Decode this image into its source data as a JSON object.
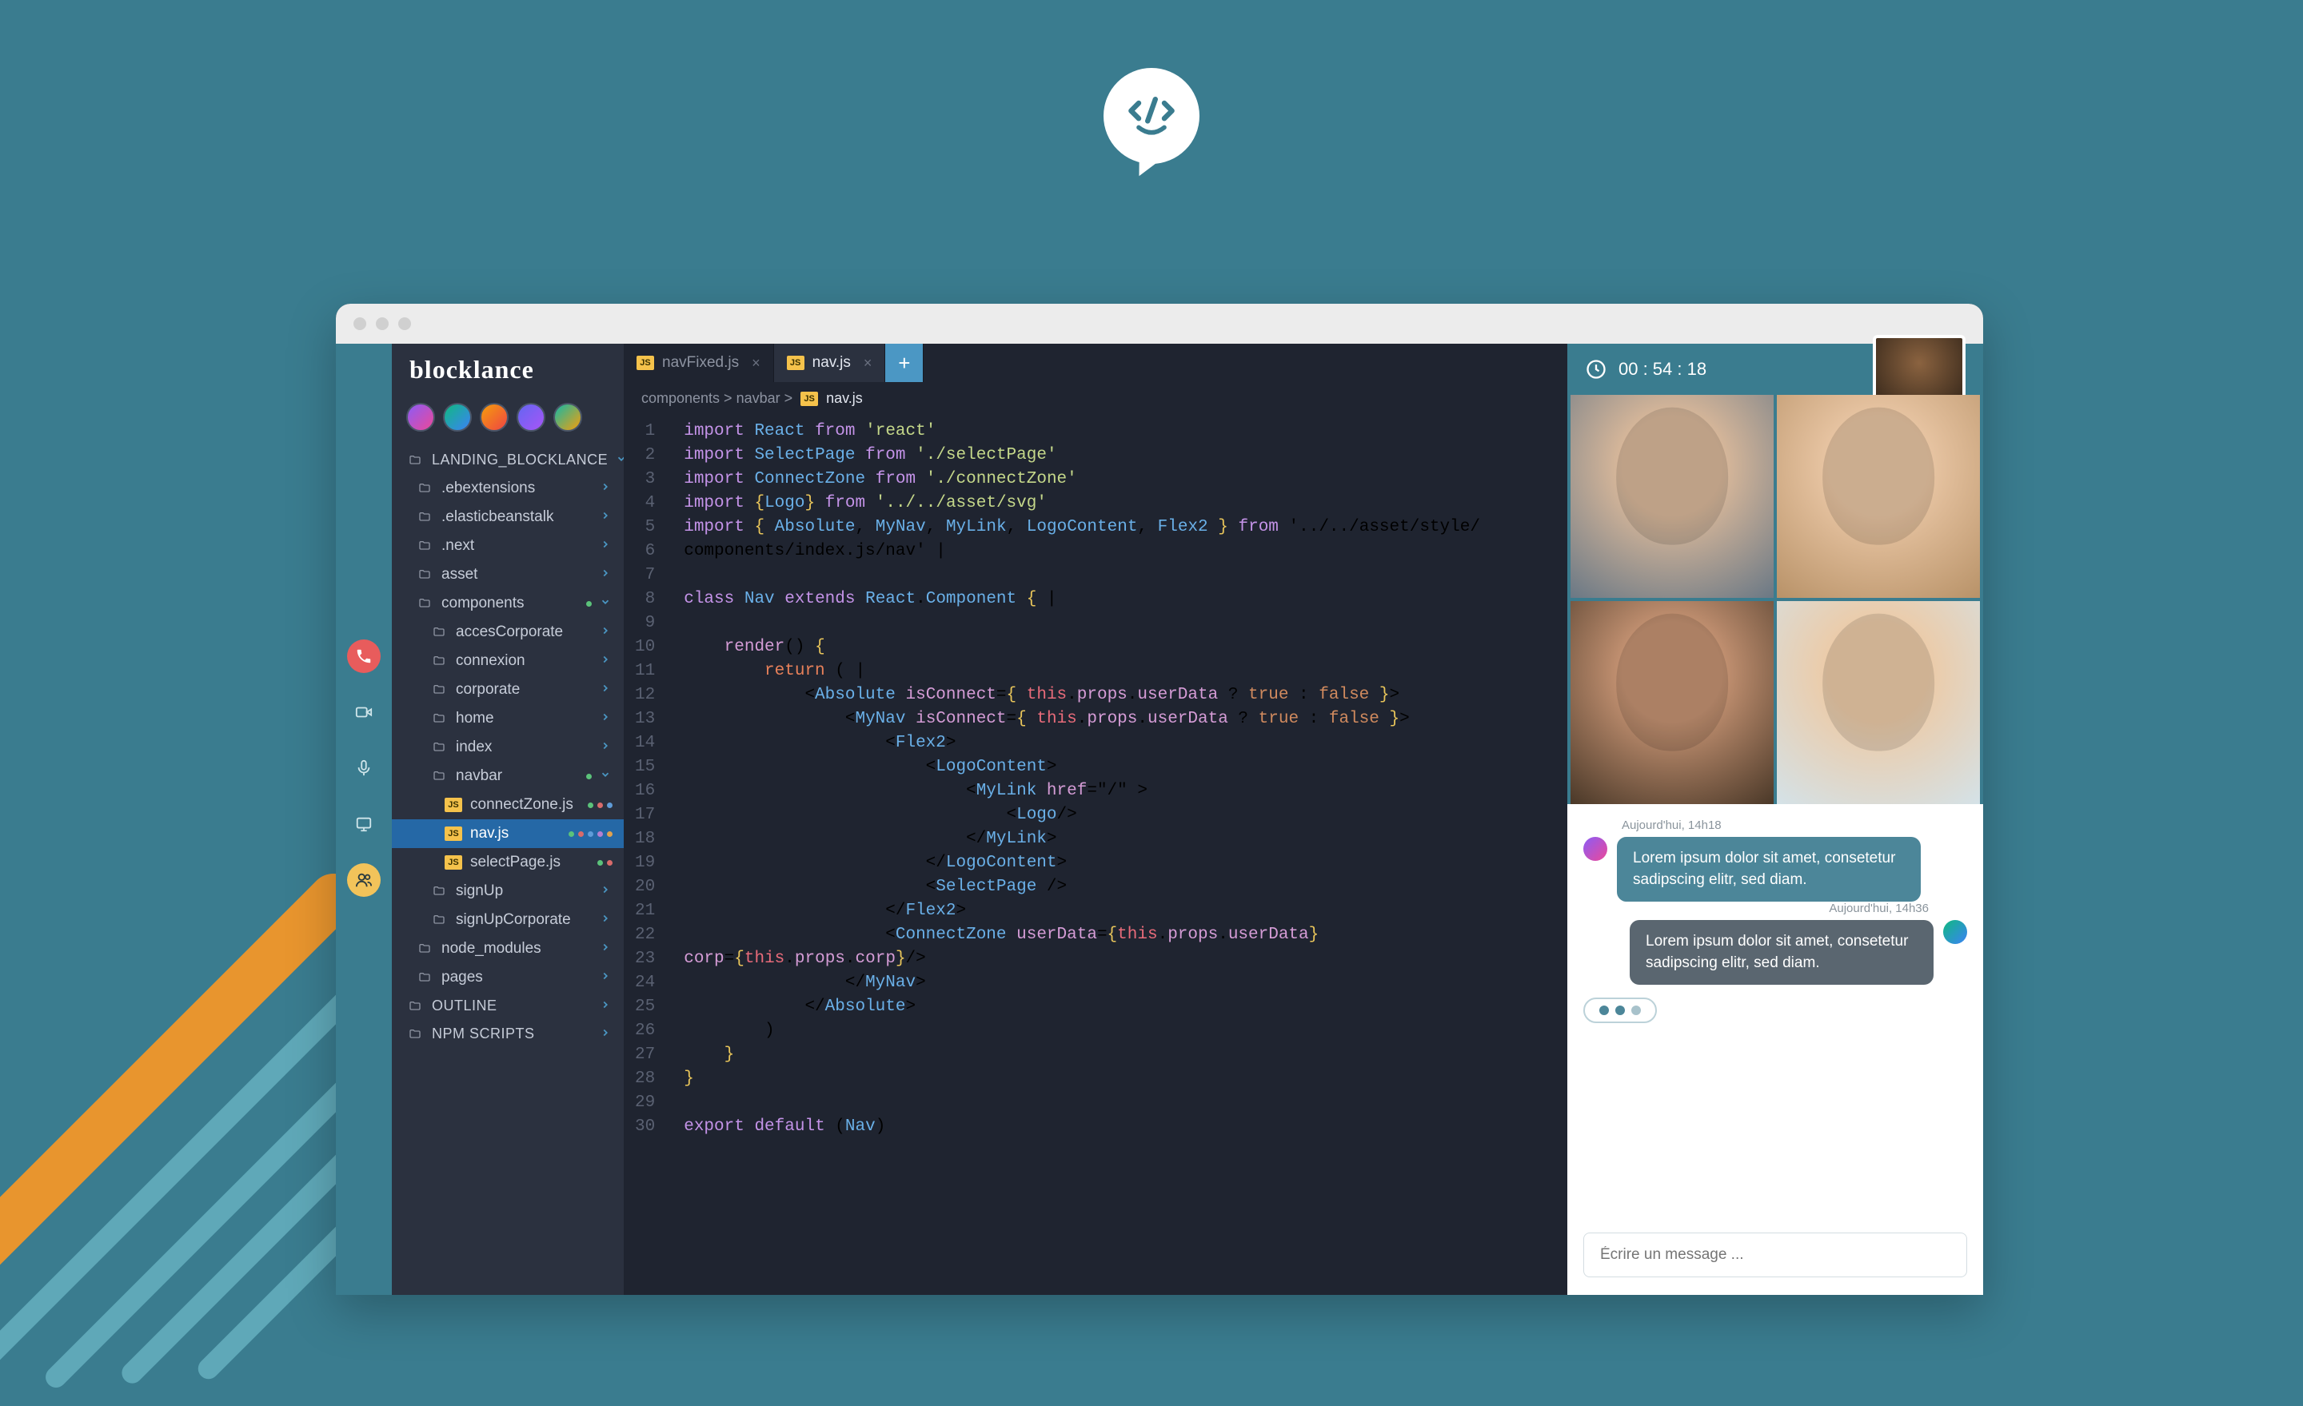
{
  "brand": "blocklance",
  "rail": {
    "call": "call",
    "video": "video",
    "mic": "mic",
    "screen": "screen",
    "people": "people"
  },
  "tabs": [
    {
      "label": "navFixed.js",
      "active": false
    },
    {
      "label": "nav.js",
      "active": true
    }
  ],
  "tab_add": "+",
  "breadcrumb": {
    "parts": "components > navbar >",
    "file": "nav.js"
  },
  "tree": {
    "root": "LANDING_BLOCKLANCE",
    "items": [
      {
        "label": ".ebextensions",
        "type": "folder",
        "indent": 1,
        "chev": "right"
      },
      {
        "label": ".elasticbeanstalk",
        "type": "folder",
        "indent": 1,
        "chev": "right"
      },
      {
        "label": ".next",
        "type": "folder",
        "indent": 1,
        "chev": "right"
      },
      {
        "label": "asset",
        "type": "folder",
        "indent": 1,
        "chev": "right"
      },
      {
        "label": "components",
        "type": "folder",
        "indent": 1,
        "chev": "down",
        "dot": "g"
      },
      {
        "label": "accesCorporate",
        "type": "folder",
        "indent": 2,
        "chev": "right"
      },
      {
        "label": "connexion",
        "type": "folder",
        "indent": 2,
        "chev": "right"
      },
      {
        "label": "corporate",
        "type": "folder",
        "indent": 2,
        "chev": "right"
      },
      {
        "label": "home",
        "type": "folder",
        "indent": 2,
        "chev": "right"
      },
      {
        "label": "index",
        "type": "folder",
        "indent": 2,
        "chev": "right"
      },
      {
        "label": "navbar",
        "type": "folder",
        "indent": 2,
        "chev": "down",
        "dot": "g"
      },
      {
        "label": "connectZone.js",
        "type": "js",
        "indent": 3,
        "dots": [
          "g",
          "r",
          "b"
        ]
      },
      {
        "label": "nav.js",
        "type": "js",
        "indent": 3,
        "selected": true,
        "dots": [
          "g",
          "r",
          "b",
          "p",
          "o"
        ]
      },
      {
        "label": "selectPage.js",
        "type": "js",
        "indent": 3,
        "dots": [
          "g",
          "r"
        ]
      },
      {
        "label": "signUp",
        "type": "folder",
        "indent": 2,
        "chev": "right"
      },
      {
        "label": "signUpCorporate",
        "type": "folder",
        "indent": 2,
        "chev": "right"
      },
      {
        "label": "node_modules",
        "type": "folder",
        "indent": 1,
        "chev": "right"
      },
      {
        "label": "pages",
        "type": "folder",
        "indent": 1,
        "chev": "right"
      }
    ],
    "outline": "OUTLINE",
    "npm": "NPM SCRIPTS"
  },
  "code_lines": [
    "import React from 'react'",
    "import SelectPage from './selectPage'",
    "import ConnectZone from './connectZone'",
    "import {Logo} from '../../asset/svg'",
    "import { Absolute, MyNav, MyLink, LogoContent, Flex2 } from '../../asset/style/",
    "components/index.js/nav' |",
    "",
    "class Nav extends React.Component { |",
    "",
    "    render() {",
    "        return ( |",
    "            <Absolute isConnect={ this.props.userData ? true : false }>",
    "                <MyNav isConnect={ this.props.userData ? true : false }>",
    "                    <Flex2>",
    "                        <LogoContent>",
    "                            <MyLink href=\"/\" >",
    "                                <Logo/>",
    "                            </MyLink>",
    "                        </LogoContent>",
    "                        <SelectPage />",
    "                    </Flex2>",
    "                    <ConnectZone userData={this.props.userData}",
    "corp={this.props.corp}/>",
    "                </MyNav>",
    "            </Absolute>",
    "        )",
    "    }",
    "}",
    "",
    "export default (Nav)"
  ],
  "timer": "00 : 54 : 18",
  "chat": {
    "messages": [
      {
        "time": "Aujourd'hui, 14h18",
        "text": "Lorem ipsum dolor sit amet, consetetur sadipscing elitr, sed diam.",
        "side": "left"
      },
      {
        "time": "Aujourd'hui, 14h36",
        "text": "Lorem ipsum dolor sit amet, consetetur sadipscing elitr, sed diam.",
        "side": "right"
      }
    ],
    "compose_placeholder": "Écrire un message ..."
  }
}
